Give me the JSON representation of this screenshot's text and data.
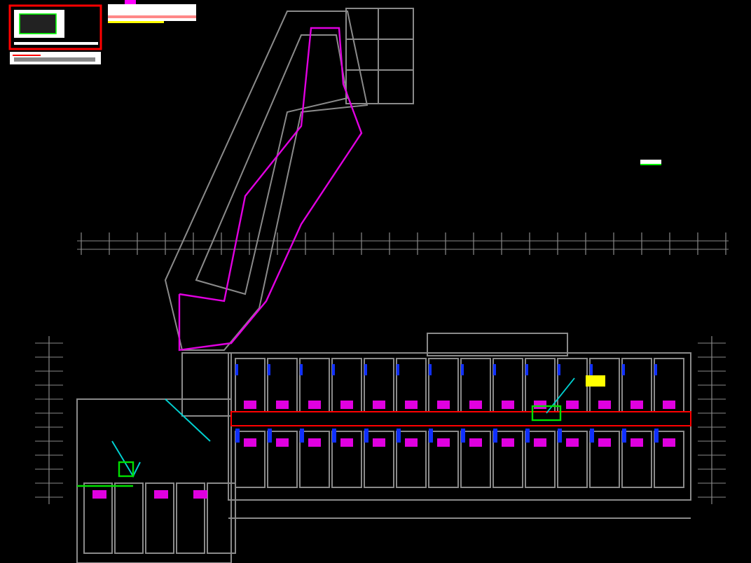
{
  "canvas": {
    "kind": "cad-floor-plan"
  }
}
